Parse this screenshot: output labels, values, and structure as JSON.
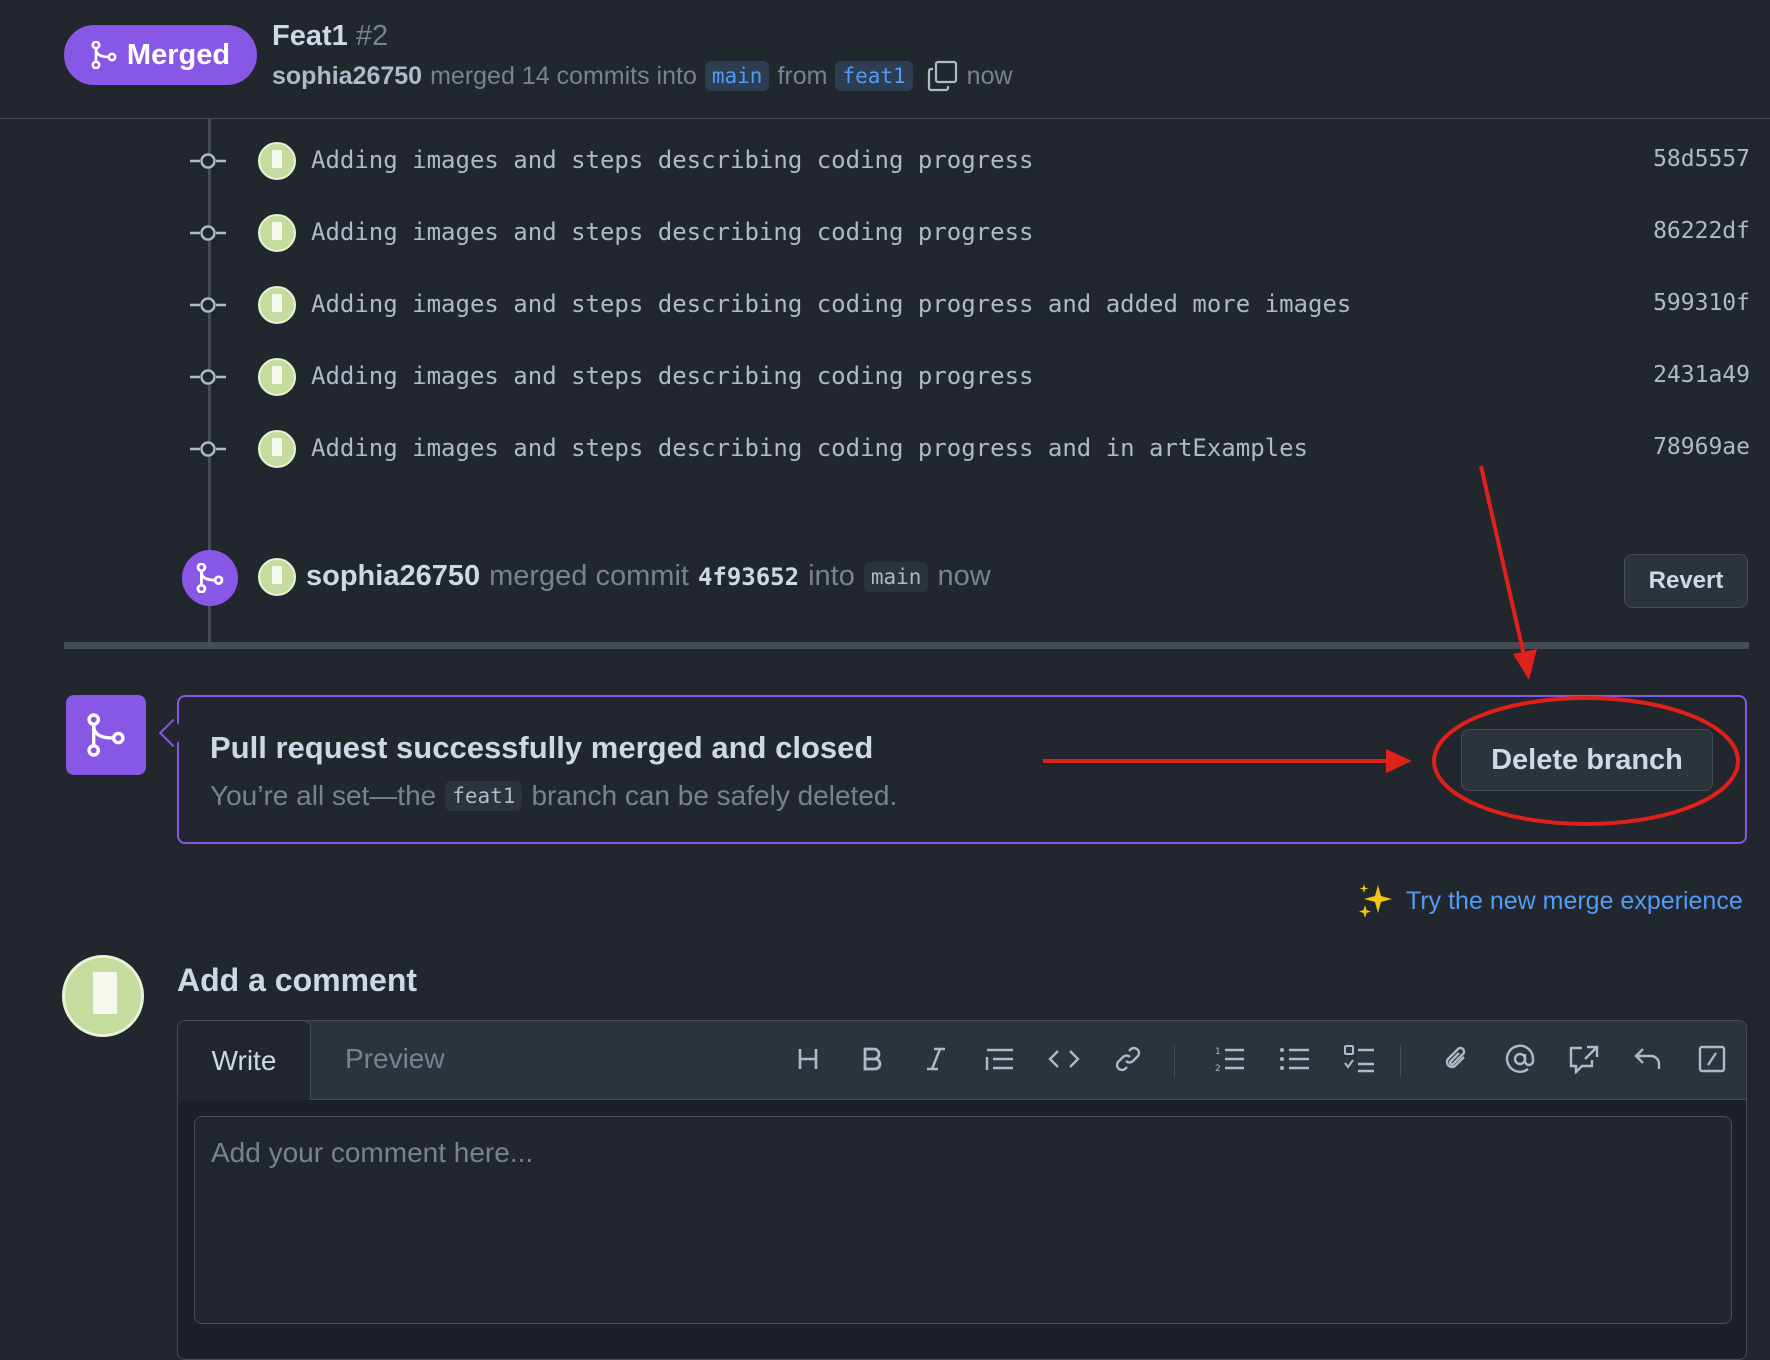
{
  "header": {
    "status_label": "Merged",
    "title": "Feat1",
    "number": "#2",
    "author": "sophia26750",
    "merged_text": "merged 14 commits into",
    "base_branch": "main",
    "from_text": "from",
    "head_branch": "feat1",
    "time": "now"
  },
  "commits": [
    {
      "message": "Adding images and steps describing coding progress",
      "sha": "58d5557"
    },
    {
      "message": "Adding images and steps describing coding progress",
      "sha": "86222df"
    },
    {
      "message": "Adding images and steps describing coding progress and added more images",
      "sha": "599310f"
    },
    {
      "message": "Adding images and steps describing coding progress",
      "sha": "2431a49"
    },
    {
      "message": "Adding images and steps describing coding progress and in artExamples",
      "sha": "78969ae"
    }
  ],
  "merge_event": {
    "author": "sophia26750",
    "text": "merged commit",
    "sha": "4f93652",
    "into_text": "into",
    "branch": "main",
    "time": "now",
    "revert_label": "Revert"
  },
  "merged_box": {
    "title": "Pull request successfully merged and closed",
    "sub_before": "You’re all set—the",
    "branch": "feat1",
    "sub_after": "branch can be safely deleted.",
    "delete_label": "Delete branch"
  },
  "new_merge_link": "Try the new merge experience",
  "comment": {
    "heading": "Add a comment",
    "tab_write": "Write",
    "tab_preview": "Preview",
    "placeholder": "Add your comment here..."
  },
  "toolbar_icons": [
    "heading-icon",
    "bold-icon",
    "italic-icon",
    "quote-icon",
    "code-icon",
    "link-icon",
    "numbered-list-icon",
    "bulleted-list-icon",
    "task-list-icon",
    "attach-icon",
    "mention-icon",
    "cross-reference-icon",
    "reply-icon",
    "slash-command-icon"
  ],
  "colors": {
    "background": "#22272e",
    "merged_purple": "#8957e5",
    "link_blue": "#539bf5",
    "annotation_red": "#e0211b"
  }
}
